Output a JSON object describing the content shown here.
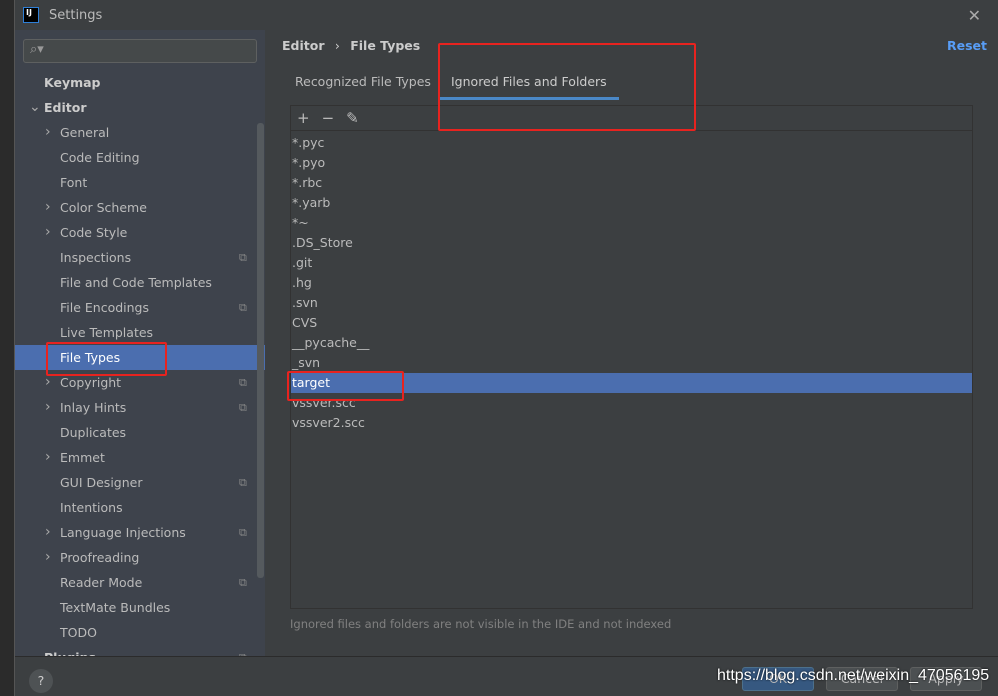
{
  "title": "Settings",
  "logo": "IJ",
  "search": {
    "placeholder": ""
  },
  "sidebar": [
    {
      "label": "Keymap",
      "bold": true,
      "indent": 0
    },
    {
      "label": "Editor",
      "bold": true,
      "indent": 0,
      "expanded": true
    },
    {
      "label": "General",
      "indent": 1,
      "arrow": true
    },
    {
      "label": "Code Editing",
      "indent": 1
    },
    {
      "label": "Font",
      "indent": 1
    },
    {
      "label": "Color Scheme",
      "indent": 1,
      "arrow": true
    },
    {
      "label": "Code Style",
      "indent": 1,
      "arrow": true
    },
    {
      "label": "Inspections",
      "indent": 1,
      "badge": true
    },
    {
      "label": "File and Code Templates",
      "indent": 1
    },
    {
      "label": "File Encodings",
      "indent": 1,
      "badge": true
    },
    {
      "label": "Live Templates",
      "indent": 1
    },
    {
      "label": "File Types",
      "indent": 1,
      "selected": true
    },
    {
      "label": "Copyright",
      "indent": 1,
      "arrow": true,
      "badge": true
    },
    {
      "label": "Inlay Hints",
      "indent": 1,
      "arrow": true,
      "badge": true
    },
    {
      "label": "Duplicates",
      "indent": 1
    },
    {
      "label": "Emmet",
      "indent": 1,
      "arrow": true
    },
    {
      "label": "GUI Designer",
      "indent": 1,
      "badge": true
    },
    {
      "label": "Intentions",
      "indent": 1
    },
    {
      "label": "Language Injections",
      "indent": 1,
      "arrow": true,
      "badge": true
    },
    {
      "label": "Proofreading",
      "indent": 1,
      "arrow": true
    },
    {
      "label": "Reader Mode",
      "indent": 1,
      "badge": true
    },
    {
      "label": "TextMate Bundles",
      "indent": 1
    },
    {
      "label": "TODO",
      "indent": 1
    },
    {
      "label": "Plugins",
      "bold": true,
      "indent": 0,
      "badge": true
    }
  ],
  "breadcrumb": {
    "parent": "Editor",
    "sep": "›",
    "current": "File Types"
  },
  "reset": "Reset",
  "tabs": [
    {
      "label": "Recognized File Types"
    },
    {
      "label": "Ignored Files and Folders",
      "active": true
    }
  ],
  "toolbar": {
    "add": "+",
    "remove": "−",
    "edit": "✎"
  },
  "ignored": [
    "*.pyc",
    "*.pyo",
    "*.rbc",
    "*.yarb",
    "*~",
    ".DS_Store",
    ".git",
    ".hg",
    ".svn",
    "CVS",
    "__pycache__",
    "_svn",
    "target",
    "vssver.scc",
    "vssver2.scc"
  ],
  "selected_ignored": "target",
  "hint": "Ignored files and folders are not visible in the IDE and not indexed",
  "footer": {
    "help": "?",
    "ok": "OK",
    "cancel": "Cancel",
    "apply": "Apply",
    "watermark": "https://blog.csdn.net/weixin_47056195"
  },
  "colors": {
    "accent": "#4b6eaf",
    "link": "#589df6",
    "annotation": "#e8231f"
  }
}
